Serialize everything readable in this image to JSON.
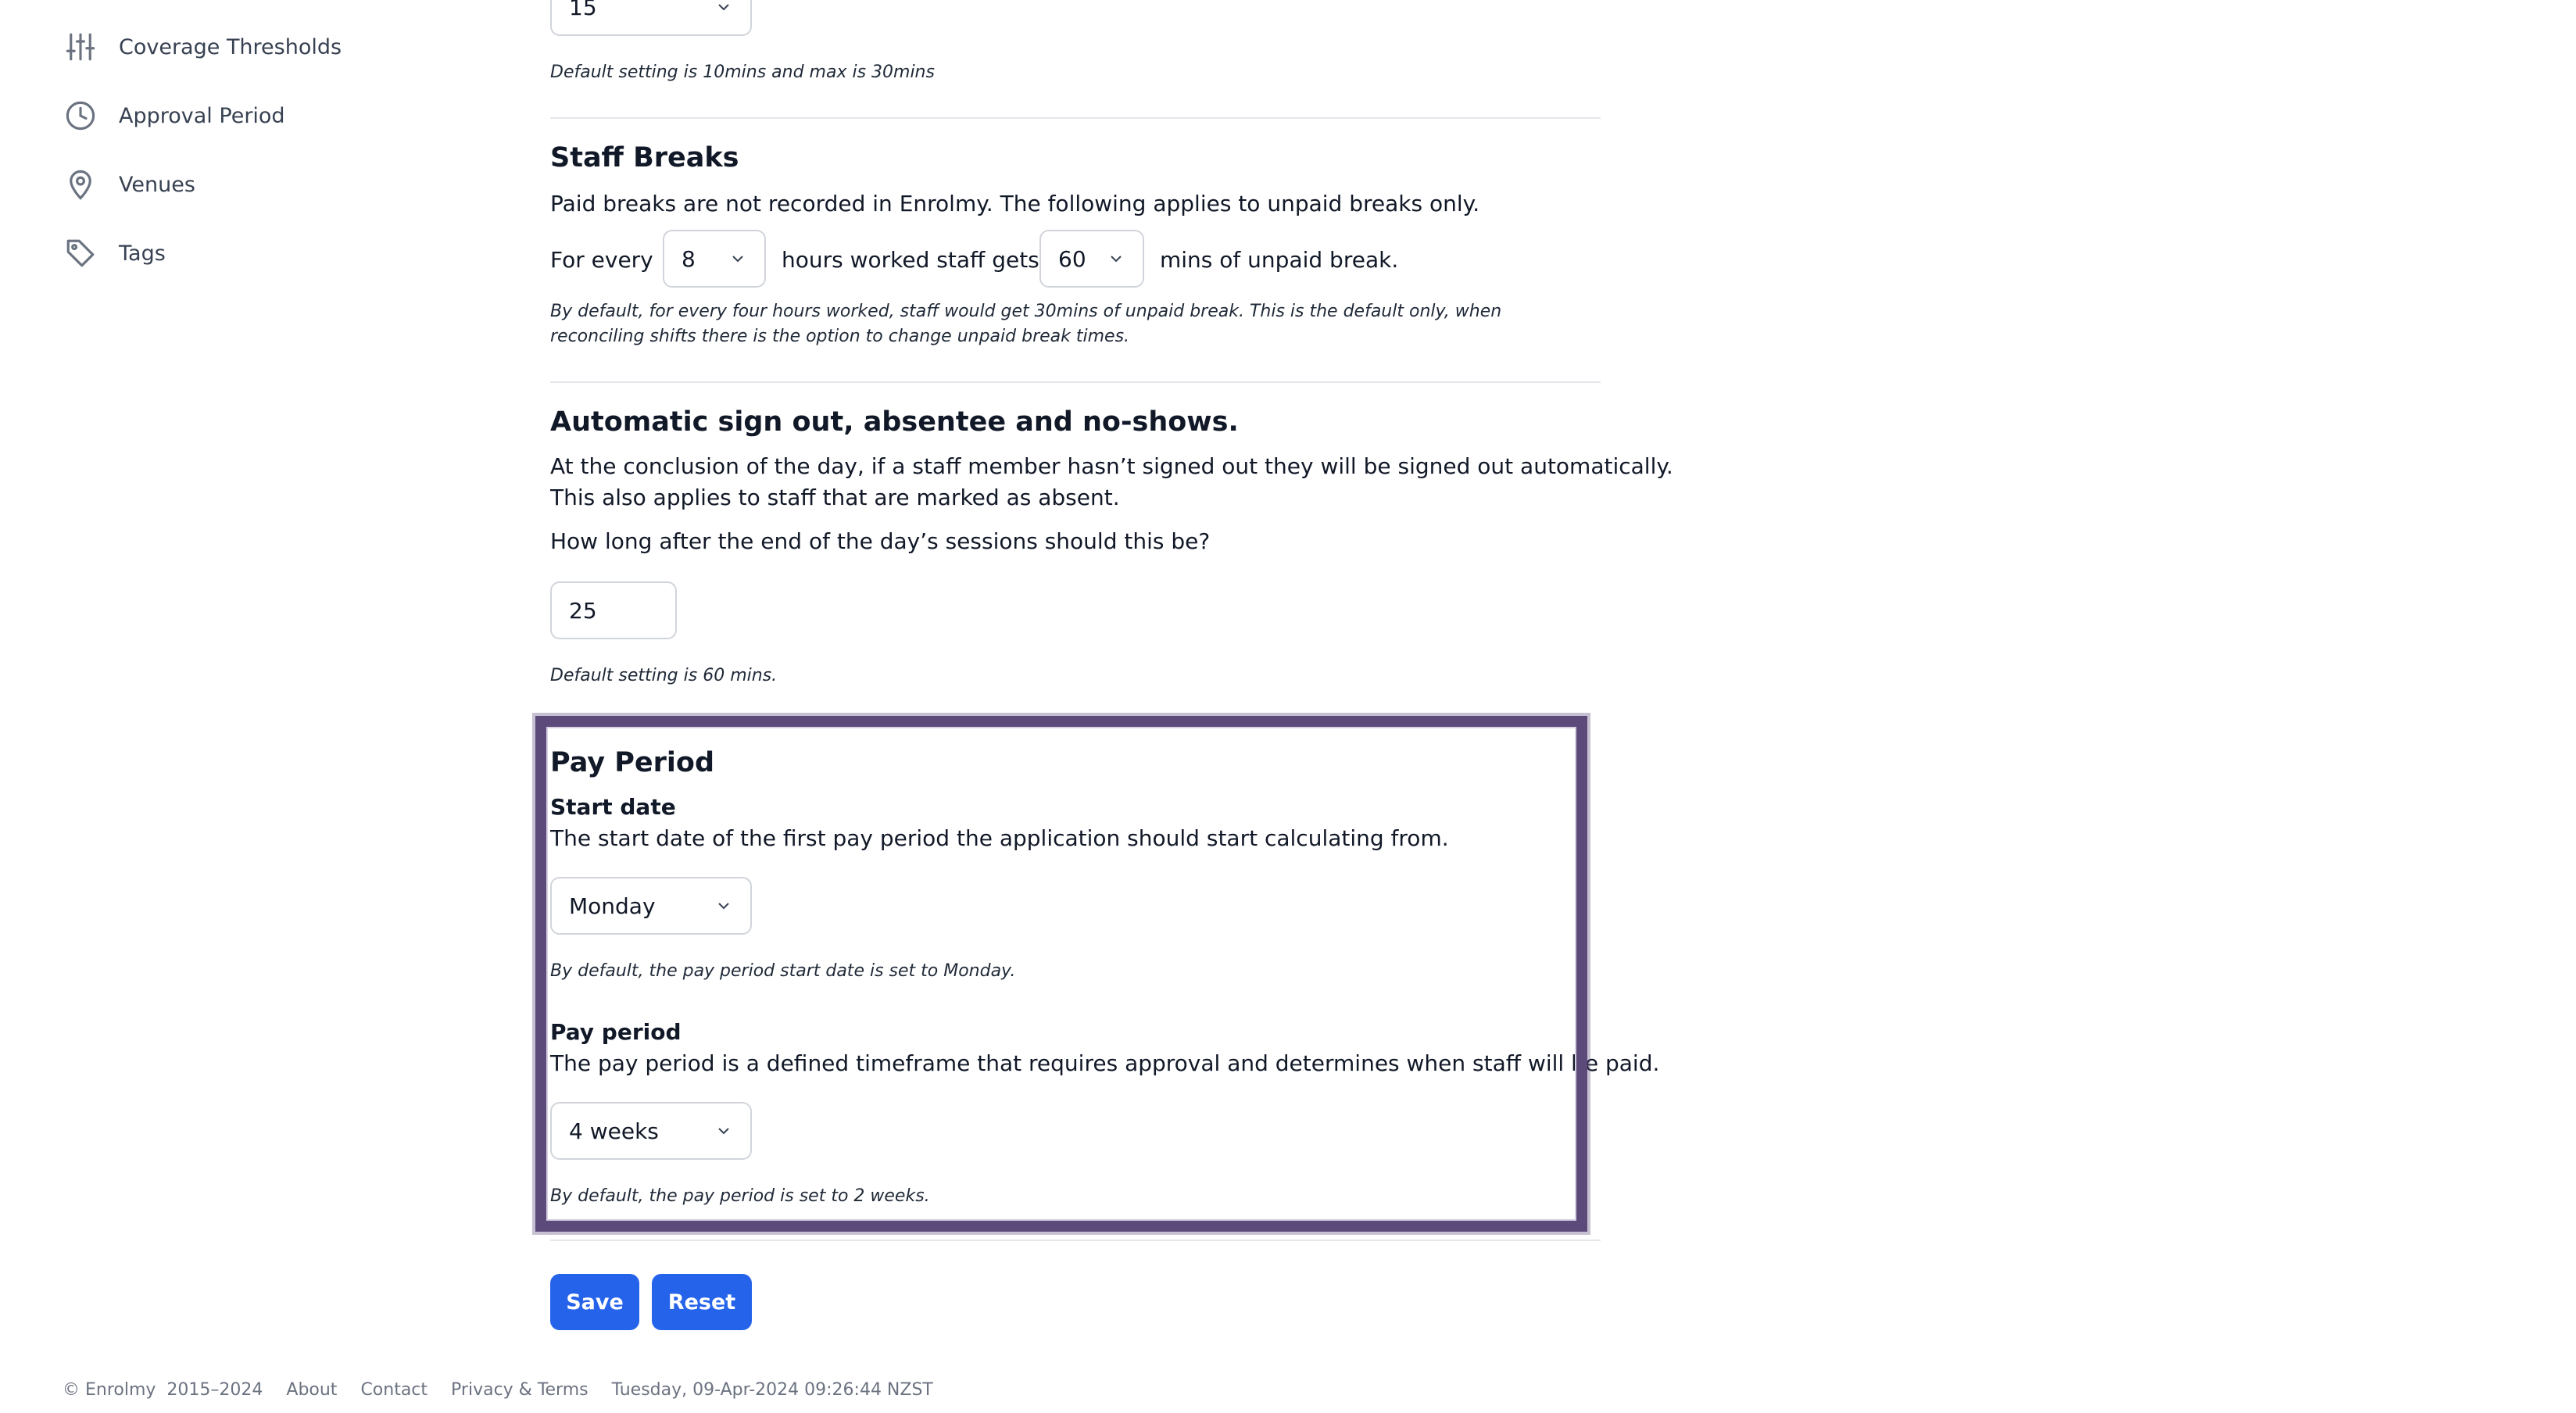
{
  "sidebar": {
    "items": [
      {
        "label": "Coverage Thresholds",
        "icon": "sliders-icon"
      },
      {
        "label": "Approval Period",
        "icon": "clock-icon"
      },
      {
        "label": "Venues",
        "icon": "map-pin-icon"
      },
      {
        "label": "Tags",
        "icon": "tag-icon"
      }
    ]
  },
  "top_section": {
    "select_value": "15",
    "hint": "Default setting is 10mins and max is 30mins"
  },
  "staff_breaks": {
    "title": "Staff Breaks",
    "description": "Paid breaks are not recorded in Enrolmy. The following applies to unpaid breaks only.",
    "for_every_label": "For every",
    "hours_value": "8",
    "hours_label": "hours worked staff gets",
    "mins_value": "60",
    "mins_label": "mins of unpaid break.",
    "hint_line1": "By default, for every four hours worked, staff would get 30mins of unpaid break. This is the default only, when",
    "hint_line2": "reconciling shifts there is the option to change unpaid break times."
  },
  "auto_signout": {
    "title": "Automatic sign out, absentee and no-shows.",
    "description_line1": "At the conclusion of the day, if a staff member hasn’t signed out they will be signed out automatically.",
    "description_line2": "This also applies to staff that are marked as absent.",
    "question": "How long after the end of the day’s sessions should this be?",
    "input_value": "25",
    "hint": "Default setting is 60 mins."
  },
  "pay_period": {
    "title": "Pay Period",
    "start_date_label": "Start date",
    "start_date_description": "The start date of the first pay period the application should start calculating from.",
    "start_date_value": "Monday",
    "start_date_hint": "By default, the pay period start date is set to Monday.",
    "period_label": "Pay period",
    "period_description": "The pay period is a defined timeframe that requires approval and determines when staff will be paid.",
    "period_value": "4 weeks",
    "period_hint": "By default, the pay period is set to 2 weeks."
  },
  "actions": {
    "save_label": "Save",
    "reset_label": "Reset"
  },
  "footer": {
    "copyright": "© Enrolmy  2015–2024",
    "about": "About",
    "contact": "Contact",
    "privacy": "Privacy & Terms",
    "timestamp": "Tuesday, 09-Apr-2024 09:26:44 NZST"
  },
  "colors": {
    "primary_button": "#2563eb",
    "highlight_border": "#5b4a7a"
  }
}
